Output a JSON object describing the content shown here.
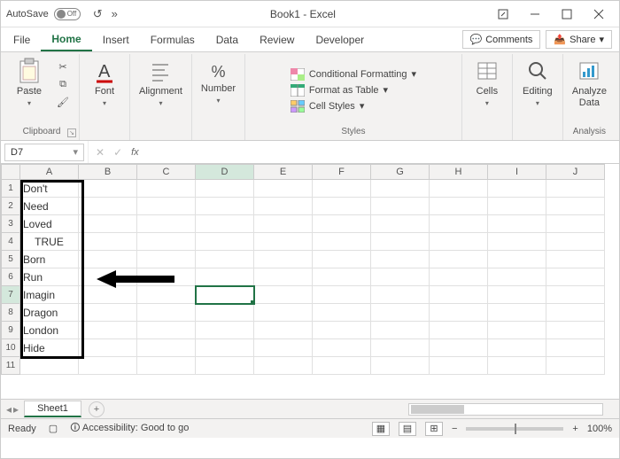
{
  "title": "Book1 - Excel",
  "autosave": {
    "label": "AutoSave",
    "state": "Off"
  },
  "menus": {
    "file": "File",
    "home": "Home",
    "insert": "Insert",
    "formulas": "Formulas",
    "data": "Data",
    "review": "Review",
    "developer": "Developer"
  },
  "comments_btn": "Comments",
  "share_btn": "Share",
  "ribbon": {
    "clipboard": "Clipboard",
    "paste": "Paste",
    "font": "Font",
    "alignment": "Alignment",
    "number": "Number",
    "styles": "Styles",
    "cond_fmt": "Conditional Formatting",
    "fmt_table": "Format as Table",
    "cell_styles": "Cell Styles",
    "cells": "Cells",
    "editing": "Editing",
    "analysis": "Analysis",
    "analyze_data": "Analyze\nData"
  },
  "namebox": "D7",
  "columns": [
    "A",
    "B",
    "C",
    "D",
    "E",
    "F",
    "G",
    "H",
    "I",
    "J"
  ],
  "rows": [
    1,
    2,
    3,
    4,
    5,
    6,
    7,
    8,
    9,
    10,
    11
  ],
  "cellsA": [
    "Don't",
    "Need",
    "Loved",
    "TRUE",
    "Born",
    "Run",
    "Imagin",
    "Dragon",
    "London",
    "Hide",
    ""
  ],
  "active_cell": {
    "row": 7,
    "col": "D"
  },
  "sheet_tab": "Sheet1",
  "status": {
    "ready": "Ready",
    "access": "Accessibility: Good to go",
    "zoom": "100%"
  },
  "chart_data": {
    "type": "table",
    "title": "Column A values",
    "categories": [
      1,
      2,
      3,
      4,
      5,
      6,
      7,
      8,
      9,
      10
    ],
    "values": [
      "Don't",
      "Need",
      "Loved",
      "TRUE",
      "Born",
      "Run",
      "Imagin",
      "Dragon",
      "London",
      "Hide"
    ]
  }
}
